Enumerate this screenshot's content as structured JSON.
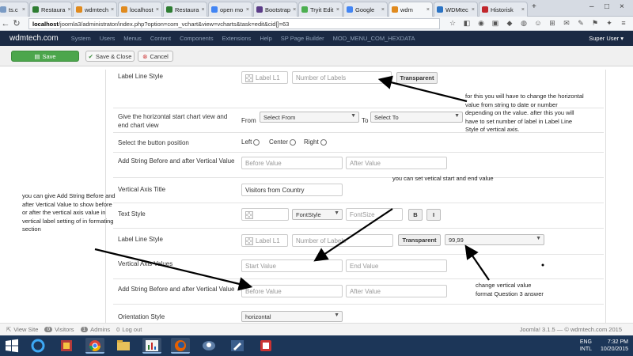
{
  "browser": {
    "tabs": [
      {
        "label": "ts.c",
        "color": "#7a9bc4"
      },
      {
        "label": "Restaura",
        "color": "#2e7d32"
      },
      {
        "label": "wdmtech",
        "color": "#e08a1e"
      },
      {
        "label": "localhost",
        "color": "#e08a1e"
      },
      {
        "label": "Restaura",
        "color": "#2e7d32"
      },
      {
        "label": "open mo",
        "color": "#4285f4"
      },
      {
        "label": "Bootstrap",
        "color": "#5b3c88"
      },
      {
        "label": "Tryit Edit",
        "color": "#4caf50"
      },
      {
        "label": "Google",
        "color": "#4285f4"
      },
      {
        "label": "wdm",
        "color": "#e08a1e",
        "active": true
      },
      {
        "label": "WDMtec",
        "color": "#2a73c4"
      },
      {
        "label": "Historisk",
        "color": "#c1272d"
      }
    ],
    "url_host": "localhost",
    "url_path": "/joomla3/administrator/index.php?option=com_vchart&view=vcharts&task=edit&cid[]=63"
  },
  "joomla": {
    "brand": "wdmtech.com",
    "menu": [
      "System",
      "Users",
      "Menus",
      "Content",
      "Components",
      "Extensions",
      "Help",
      "SP Page Builder",
      "MOD_MENU_COM_HEXDATA"
    ],
    "user": "Super User ▾"
  },
  "toolbar": {
    "save": "Save",
    "save_close": "Save & Close",
    "cancel": "Cancel"
  },
  "form": {
    "label_line_style_1": "Label Line Style",
    "label_placeholder": "Label L1",
    "num_labels_placeholder": "Number of Labels",
    "transparent": "Transparent",
    "horizontal_start_end": "Give the horizontal start chart view and end chart view",
    "from": "From",
    "select_from": "Select From",
    "to": "To",
    "select_to": "Select To",
    "button_position": "Select the button position",
    "left": "Left",
    "center": "Center",
    "right": "Right",
    "add_string_vertical_1": "Add String Before and after Vertical Value",
    "before_value": "Before Value",
    "after_value": "After Value",
    "vertical_axis_title": "Vertical Axis Title",
    "vertical_axis_title_value": "Visitors from Country",
    "text_style": "Text Style",
    "font_style": "FontStyle",
    "font_size": "FontSize",
    "bold": "B",
    "italic": "I",
    "label_line_style_2": "Label Line Style",
    "format_value": "99,99",
    "vertical_axis_values": "Vertical Axis Values",
    "start_value": "Start Value",
    "end_value": "End Value",
    "add_string_vertical_2": "Add String Before and after Vertical Value",
    "orientation_style": "Orientation Style",
    "orientation_value": "horizontal"
  },
  "annotations": {
    "note_horizontal": "for this you will have to change the horizontal value from string to date or number depending on the value. after this you will have to set number of label in Label Line Style of vertical axis.",
    "note_vertical_start_end": "you can set vetical start and end value",
    "note_add_string": "you can give Add String Before and after Vertical Value to show before or after the vertical axis value in vertical label setting of in formating section",
    "note_format": "change vertical value format Question 3 answer"
  },
  "status": {
    "view_site": "View Site",
    "visitors_count": "0",
    "visitors": "Visitors",
    "admins_count": "1",
    "admins": "Admins",
    "logout_count": "0",
    "logout": "Log out",
    "version": "Joomla! 3.1.5 — © wdmtech.com 2015"
  },
  "taskbar": {
    "lang_1": "ENG",
    "lang_2": "INTL",
    "time": "7:32 PM",
    "date": "10/20/2015"
  }
}
